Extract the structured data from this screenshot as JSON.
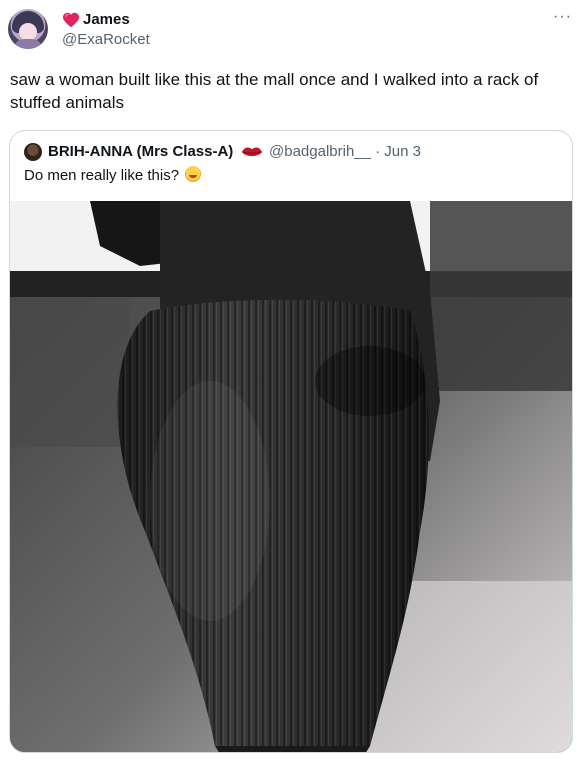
{
  "tweet": {
    "author_name": "James",
    "author_handle": "@ExaRocket",
    "more_label": "···",
    "text": "saw a woman built like this at the mall once and I walked into a rack of stuffed animals"
  },
  "quoted_tweet": {
    "author_name": "BRIH-ANNA (Mrs Class-A)",
    "author_handle": "@badgalbrih__",
    "date": "· Jun 3",
    "text": "Do men really like this?"
  },
  "icons": {
    "author_badge": "heart-icon",
    "quoted_badge": "kiss-mark-icon",
    "text_emoji": "face-hand-over-mouth-icon"
  },
  "colors": {
    "text_primary": "#0f1419",
    "text_secondary": "#536471",
    "border": "#cfd9de",
    "heart": "#e0245e",
    "lips": "#c4152b"
  }
}
